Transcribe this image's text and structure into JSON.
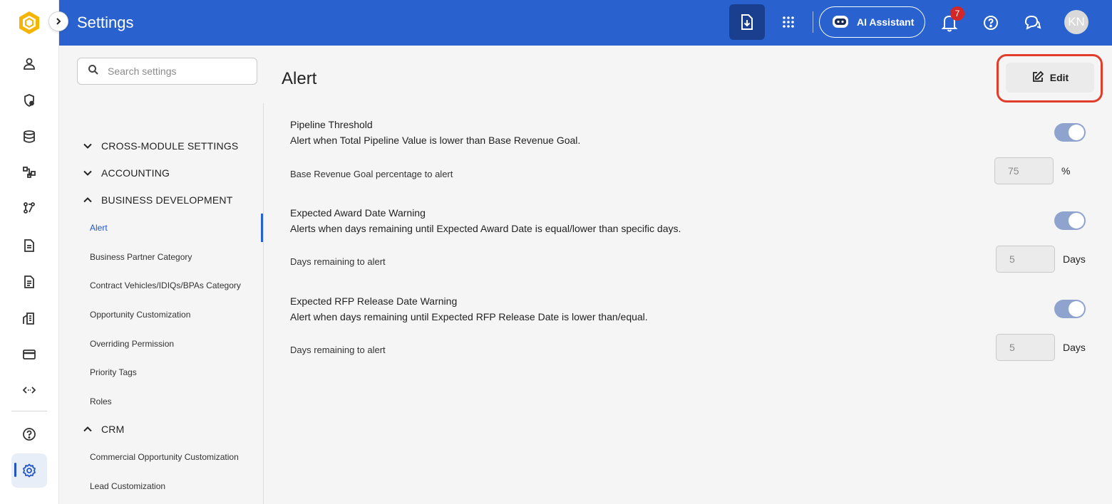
{
  "header": {
    "title": "Settings",
    "ai_assistant_label": "AI Assistant",
    "notification_count": "7",
    "avatar_initials": "KN"
  },
  "colors": {
    "topbar": "#2961ce",
    "accent": "#2156c9",
    "highlight": "#e23d2b",
    "toggle_on": "#8ea4cf"
  },
  "rail": {
    "icons": [
      "person-icon",
      "shield-icon",
      "database-icon",
      "org-chart-icon",
      "workflow-icon",
      "document-icon",
      "report-icon",
      "buildings-icon",
      "card-icon",
      "code-icon",
      "help-icon",
      "settings-icon"
    ],
    "active": "settings-icon"
  },
  "search": {
    "placeholder": "Search settings"
  },
  "nav": {
    "groups": [
      {
        "label": "CROSS-MODULE SETTINGS",
        "expanded": false
      },
      {
        "label": "ACCOUNTING",
        "expanded": false
      },
      {
        "label": "BUSINESS DEVELOPMENT",
        "expanded": true,
        "items": [
          "Alert",
          "Business Partner Category",
          "Contract Vehicles/IDIQs/BPAs Category",
          "Opportunity Customization",
          "Overriding Permission",
          "Priority Tags",
          "Roles"
        ]
      },
      {
        "label": "CRM",
        "expanded": true,
        "items": [
          "Commercial Opportunity Customization",
          "Lead Customization"
        ]
      }
    ],
    "active_item": "Alert"
  },
  "main": {
    "title": "Alert",
    "edit_label": "Edit",
    "settings": [
      {
        "title": "Pipeline Threshold",
        "description": "Alert when Total Pipeline Value is lower than Base Revenue Goal.",
        "enabled": true,
        "field_label": "Base Revenue Goal percentage to alert",
        "value": "75",
        "unit": "%"
      },
      {
        "title": "Expected Award Date Warning",
        "description": "Alerts when days remaining until Expected Award Date is equal/lower than specific days.",
        "enabled": true,
        "field_label": "Days remaining to alert",
        "value": "5",
        "unit": "Days"
      },
      {
        "title": "Expected RFP Release Date Warning",
        "description": "Alert when days remaining until Expected RFP Release Date is lower than/equal.",
        "enabled": true,
        "field_label": "Days remaining to alert",
        "value": "5",
        "unit": "Days"
      }
    ]
  }
}
